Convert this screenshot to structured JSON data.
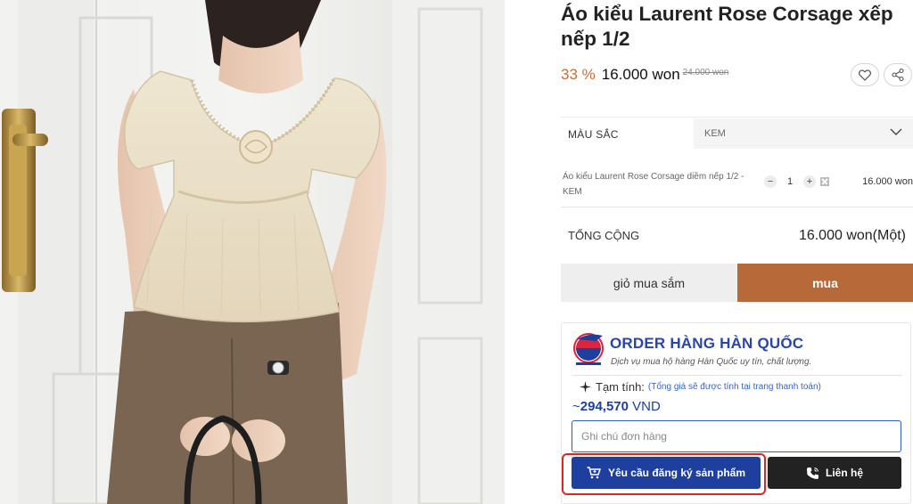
{
  "product": {
    "title": "Áo kiểu Laurent Rose Corsage xếp nếp 1/2",
    "discount": "33 %",
    "price": "16.000 won",
    "old_price": "24.000 won",
    "image_alt": "product-photo"
  },
  "options": {
    "color_label": "MÀU SẮC",
    "color_value": "KEM"
  },
  "cart_item": {
    "name": "Áo kiểu Laurent Rose Corsage diềm nếp 1/2 - KEM",
    "qty_minus": "−",
    "qty": "1",
    "qty_plus": "+",
    "price": "16.000 won"
  },
  "total": {
    "label": "TỔNG CỘNG",
    "value": "16.000 won(Một)"
  },
  "buttons": {
    "cart": "giỏ mua sắm",
    "buy": "mua"
  },
  "order_service": {
    "title": "ORDER HÀNG HÀN QUỐC",
    "subtitle": "Dịch vụ mua hộ hàng Hàn Quốc uy tín, chất lượng.",
    "subtotal_label": "Tạm tính:",
    "subtotal_note": "(Tổng giá sẽ được tính tại trang thanh toán)",
    "approx_prefix": "~",
    "approx_amount": "294,570",
    "approx_currency": "VND",
    "note_placeholder": "Ghi chú đơn hàng",
    "request_button": "Yêu cầu đăng ký sản phẩm",
    "contact_button": "Liên hệ"
  },
  "colors": {
    "accent": "#b7693a",
    "brand_blue": "#1f3f9e",
    "highlight_red": "#d62828"
  },
  "icons": [
    "heart-icon",
    "share-icon",
    "chevron-down-icon",
    "sparkle-icon",
    "cart-icon",
    "phone-icon"
  ]
}
